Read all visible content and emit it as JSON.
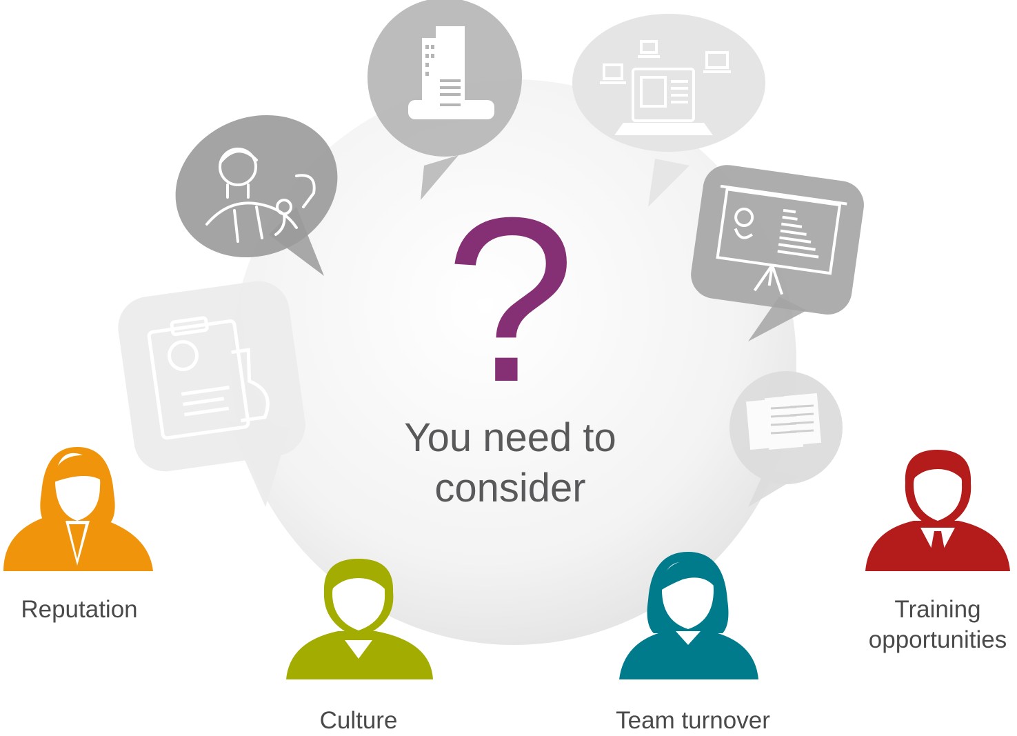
{
  "center": {
    "symbol": "?",
    "line1": "You need to",
    "line2": "consider"
  },
  "people": [
    {
      "label": "Reputation",
      "icon": "woman-icon",
      "color": "#f0950b"
    },
    {
      "label": "Culture",
      "icon": "man-icon",
      "color": "#a3ac00"
    },
    {
      "label": "Team turnover",
      "icon": "woman-icon",
      "color": "#007b8c"
    },
    {
      "label": "Training",
      "label2": "opportunities",
      "icon": "businessman-icon",
      "color": "#b41b1b"
    }
  ],
  "bubbles": [
    {
      "icon": "doctor-icon"
    },
    {
      "icon": "hospital-building-icon"
    },
    {
      "icon": "networked-computers-icon"
    },
    {
      "icon": "presentation-board-icon"
    },
    {
      "icon": "documents-icon"
    },
    {
      "icon": "clipboard-microscope-icon"
    }
  ],
  "colors": {
    "accent": "#852f74",
    "text": "#59585a"
  }
}
